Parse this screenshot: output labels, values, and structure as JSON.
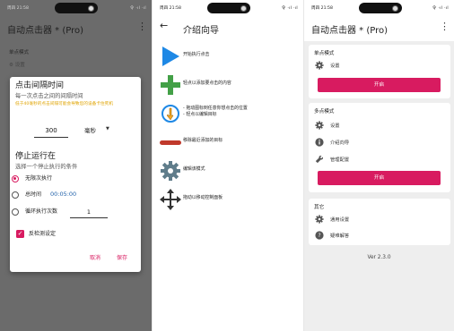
{
  "status": {
    "time": "周四 21:58",
    "signal_text": "令 ·ıl ·ıl",
    "time_p3": "周四 21:58"
  },
  "panel1": {
    "app_title": "自动点击器 * (Pro)",
    "menu_icon": "more-vert-icon",
    "bg_section": "单点模式",
    "bg_setting": "设置",
    "dialog": {
      "title": "点击间隔时间",
      "subtitle": "每一次点击之间的间隔时间",
      "warning": "低于40毫秒的点击间隔可能会导致您的设备卡住死机",
      "interval_value": "300",
      "interval_unit": "毫秒",
      "stop_title": "停止运行在",
      "stop_subtitle": "选择一个停止执行的条件",
      "opt_infinite": "无限次执行",
      "opt_total_time": "总时间",
      "total_time_value": "00:05:00",
      "opt_loop_count": "循环执行次数",
      "loop_count_value": "1",
      "anti_detect": "反检测设定",
      "cancel": "取消",
      "save": "保存"
    }
  },
  "panel2": {
    "title": "介绍向导",
    "items": [
      {
        "icon": "play-triangle-icon",
        "lines": [
          "开始执行点击"
        ]
      },
      {
        "icon": "add-plus-icon",
        "lines": [
          "轻点以添加要点击的内容"
        ]
      },
      {
        "icon": "click-target-icon",
        "lines": [
          "- 拖动图标到任意你想点击的位置",
          "- 轻点以编辑目标"
        ]
      },
      {
        "icon": "remove-bar-icon",
        "lines": [
          "移除最近添加的目标"
        ]
      },
      {
        "icon": "settings-gear-icon",
        "lines": [
          "编辑该模式"
        ]
      },
      {
        "icon": "move-arrows-icon",
        "lines": [
          "拖动以移动控制面板"
        ]
      }
    ]
  },
  "panel3": {
    "app_title": "自动点击器 * (Pro)",
    "single": {
      "title": "单点模式",
      "settings": "设置",
      "start": "开启"
    },
    "multi": {
      "title": "多点模式",
      "settings": "设置",
      "guide": "介绍向导",
      "manage": "管理配置",
      "start": "开启"
    },
    "other": {
      "title": "其它",
      "general": "通用设置",
      "faq": "疑难解答"
    },
    "version": "Ver 2.3.0"
  },
  "colors": {
    "accent": "#d81b60",
    "play_blue": "#1e88e5",
    "add_green": "#43a047",
    "remove_red": "#c0392b",
    "warning": "#e0a400"
  }
}
